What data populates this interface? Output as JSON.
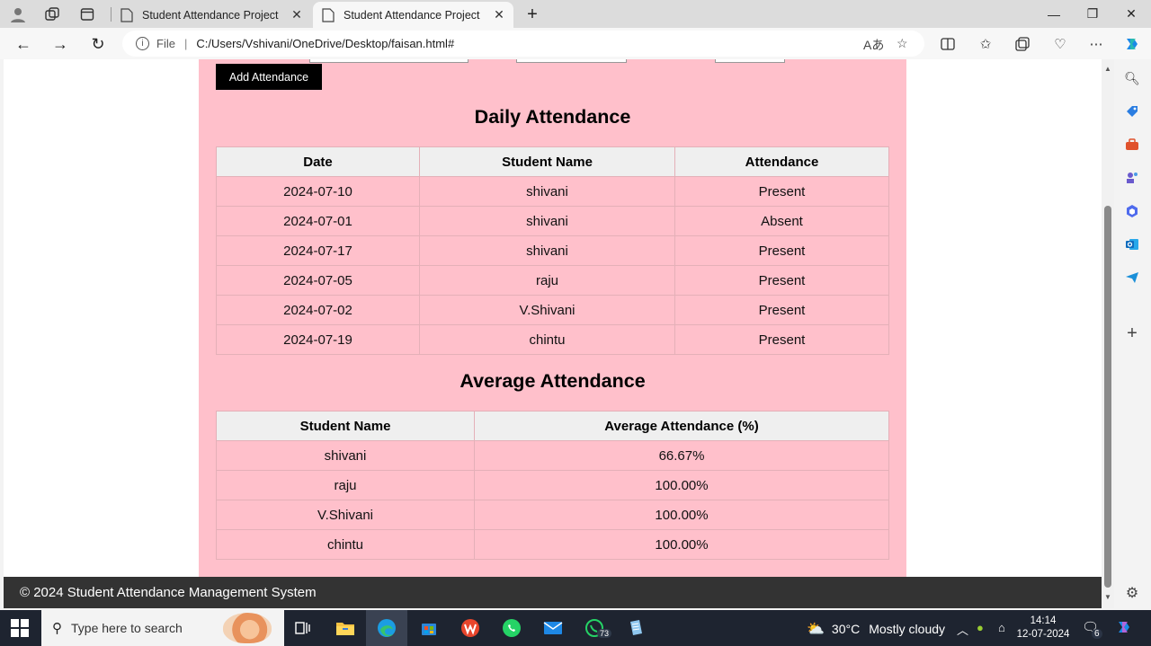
{
  "browser": {
    "tabs": [
      {
        "title": "Student Attendance Project",
        "active": false
      },
      {
        "title": "Student Attendance Project",
        "active": true
      }
    ],
    "address": {
      "scheme_label": "File",
      "url": "C:/Users/Vshivani/OneDrive/Desktop/faisan.html#"
    }
  },
  "page": {
    "add_button": "Add Attendance",
    "daily": {
      "title": "Daily Attendance",
      "headers": [
        "Date",
        "Student Name",
        "Attendance"
      ],
      "rows": [
        [
          "2024-07-10",
          "shivani",
          "Present"
        ],
        [
          "2024-07-01",
          "shivani",
          "Absent"
        ],
        [
          "2024-07-17",
          "shivani",
          "Present"
        ],
        [
          "2024-07-05",
          "raju",
          "Present"
        ],
        [
          "2024-07-02",
          "V.Shivani",
          "Present"
        ],
        [
          "2024-07-19",
          "chintu",
          "Present"
        ]
      ]
    },
    "average": {
      "title": "Average Attendance",
      "headers": [
        "Student Name",
        "Average Attendance (%)"
      ],
      "rows": [
        [
          "shivani",
          "66.67%"
        ],
        [
          "raju",
          "100.00%"
        ],
        [
          "V.Shivani",
          "100.00%"
        ],
        [
          "chintu",
          "100.00%"
        ]
      ]
    },
    "footer": "© 2024 Student Attendance Management System"
  },
  "taskbar": {
    "search_placeholder": "Type here to search",
    "whatsapp_badge": "73",
    "weather_temp": "30°C",
    "weather_text": "Mostly cloudy",
    "time": "14:14",
    "date": "12-07-2024",
    "notification_count": "6"
  },
  "colors": {
    "page_bg": "#ffc0cb",
    "header_bg": "#efefef",
    "footer_bg": "#333333",
    "button_bg": "#000000"
  }
}
